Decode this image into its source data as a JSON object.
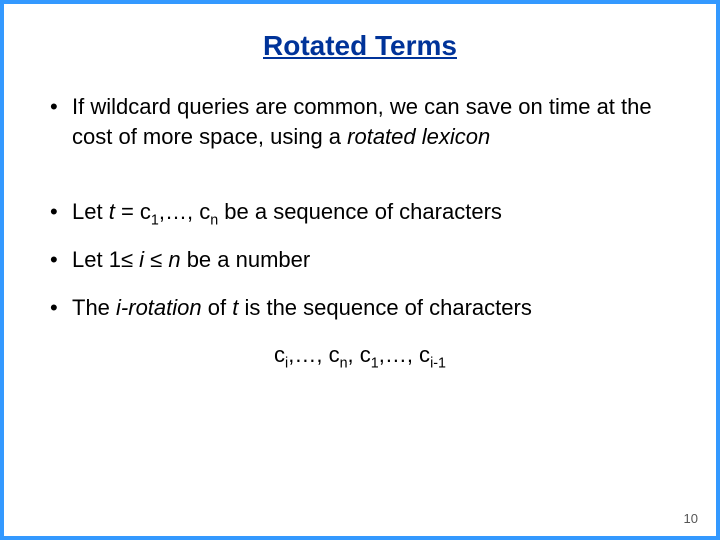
{
  "title": "Rotated Terms",
  "bullets": {
    "b1_pre": "If wildcard queries are common, we can save on time at the cost of more space, using a ",
    "b1_italic": "rotated lexicon",
    "b2_a": "Let ",
    "b2_t": "t",
    "b2_b": " = c",
    "b2_sub1": "1",
    "b2_c": ",…, c",
    "b2_subn": "n",
    "b2_d": " be a sequence of characters",
    "b3_a": "Let 1",
    "b3_le1": "≤",
    "b3_i": " i ",
    "b3_le2": "≤",
    "b3_n": " n",
    "b3_b": " be a number",
    "b4_a": "The ",
    "b4_i": "i",
    "b4_rot": "-rotation",
    "b4_b": " of ",
    "b4_t": "t",
    "b4_c": " is the sequence of characters"
  },
  "formula": {
    "c": "c",
    "sub_i": "i",
    "sep": ",…, ",
    "sub_n": "n",
    "sep2": ", c",
    "sub_1": "1",
    "sep3": ",…, c",
    "sub_im1": "i-1"
  },
  "pagenum": "10"
}
